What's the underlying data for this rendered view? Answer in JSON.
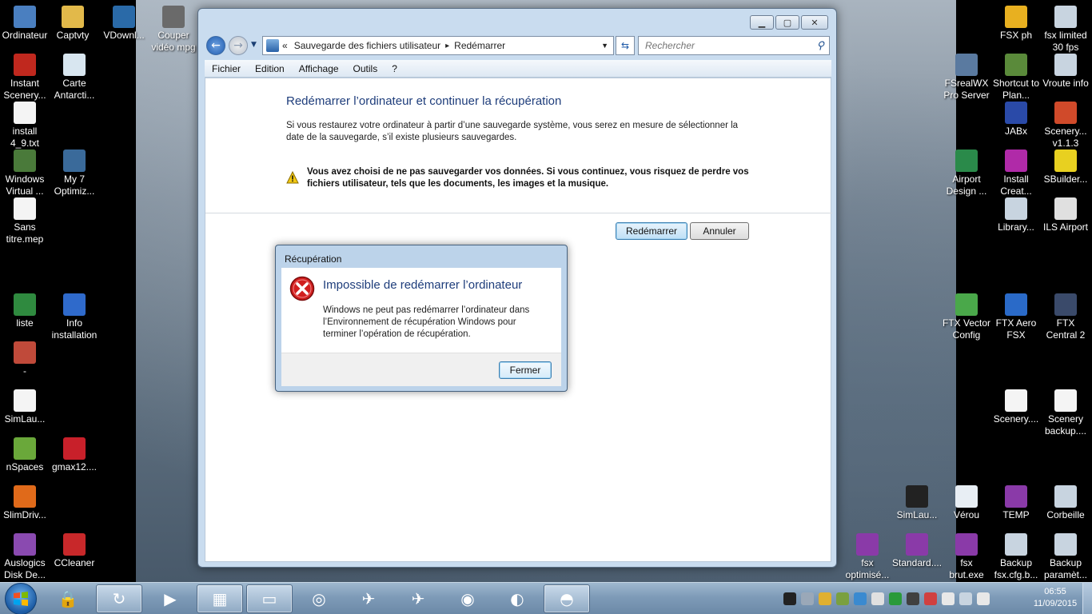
{
  "desktop": {
    "left_icons": [
      {
        "label": "Ordinateur",
        "icon": "computer-icon",
        "color": "#4a7fc0"
      },
      {
        "label": "Captvty",
        "icon": "folder-icon",
        "color": "#e2b94a"
      },
      {
        "label": "VDownl...",
        "icon": "vdownloader-icon",
        "color": "#2a6aa8"
      },
      {
        "label": "Couper vidéo mpg",
        "icon": "video-editor-icon",
        "color": "#6a6a6a"
      },
      {
        "label": "Instant Scenery...",
        "icon": "pdf-icon",
        "color": "#c0281e"
      },
      {
        "label": "Carte Antarcti...",
        "icon": "map-icon",
        "color": "#d8e6f0"
      },
      {
        "label": "install 4_9.txt",
        "icon": "text-file-icon",
        "color": "#f4f4f4"
      },
      {
        "label": "Windows Virtual ...",
        "icon": "virtual-pc-icon",
        "color": "#4a7a3a"
      },
      {
        "label": "My 7 Optimiz...",
        "icon": "optimizer-icon",
        "color": "#3a6a9a"
      },
      {
        "label": "Sans titre.mep",
        "icon": "document-icon",
        "color": "#f4f4f4"
      },
      {
        "label": "liste",
        "icon": "spreadsheet-icon",
        "color": "#2f8a3f"
      },
      {
        "label": "Info installation",
        "icon": "info-icon",
        "color": "#2f6acb"
      },
      {
        "label": "-",
        "icon": "flag-icon",
        "color": "#c04a3a"
      },
      {
        "label": "SimLau...",
        "icon": "document-icon",
        "color": "#f4f4f4"
      },
      {
        "label": "nSpaces",
        "icon": "nspaces-icon",
        "color": "#6aa83a"
      },
      {
        "label": "gmax12....",
        "icon": "gmax-icon",
        "color": "#c8202a"
      },
      {
        "label": "SlimDriv...",
        "icon": "slimdrivers-icon",
        "color": "#e06a1a"
      },
      {
        "label": "Auslogics Disk De...",
        "icon": "defrag-icon",
        "color": "#8a4ab0"
      },
      {
        "label": "CCleaner",
        "icon": "ccleaner-icon",
        "color": "#c8282a"
      }
    ],
    "right_icons": [
      {
        "label": "FSX ph",
        "icon": "fsx-icon",
        "color": "#e8b020"
      },
      {
        "label": "fsx limited 30 fps",
        "icon": "settings-shortcut-icon",
        "color": "#c8d4e0"
      },
      {
        "label": "FSrealWX Pro Server",
        "icon": "weather-server-icon",
        "color": "#5a7aa0"
      },
      {
        "label": "Shortcut to Plan...",
        "icon": "plane-icon",
        "color": "#5a8a3a"
      },
      {
        "label": "Vroute info",
        "icon": "window-icon",
        "color": "#c8d4e0"
      },
      {
        "label": "JABx",
        "icon": "jabx-icon",
        "color": "#2a4aa8"
      },
      {
        "label": "Scenery... v1.1.3",
        "icon": "scenery-icon",
        "color": "#d04a2a"
      },
      {
        "label": "Airport Design ...",
        "icon": "airport-design-icon",
        "color": "#2a8a4a"
      },
      {
        "label": "Install Creat...",
        "icon": "install-icon",
        "color": "#b02aa8"
      },
      {
        "label": "SBuilder...",
        "icon": "sbuilder-icon",
        "color": "#e8d020"
      },
      {
        "label": "Library...",
        "icon": "library-icon",
        "color": "#c8d4e0"
      },
      {
        "label": "ILS Airport",
        "icon": "airport-icon",
        "color": "#e0e0e0"
      },
      {
        "label": "FTX Vector Config",
        "icon": "ftx-vector-icon",
        "color": "#4aa84a"
      },
      {
        "label": "FTX Aero FSX",
        "icon": "ftx-aero-icon",
        "color": "#2a6ac8"
      },
      {
        "label": "FTX Central 2",
        "icon": "ftx-central-icon",
        "color": "#3a4a6a"
      },
      {
        "label": "Scenery....",
        "icon": "document-icon",
        "color": "#f4f4f4"
      },
      {
        "label": "Scenery backup....",
        "icon": "document-icon",
        "color": "#f4f4f4"
      },
      {
        "label": "SimLau...",
        "icon": "airplane-icon",
        "color": "#222222"
      },
      {
        "label": "Vérou",
        "icon": "document-icon",
        "color": "#e8eef4"
      },
      {
        "label": "TEMP",
        "icon": "winrar-icon",
        "color": "#8a3aa8"
      },
      {
        "label": "Corbeille",
        "icon": "recycle-bin-icon",
        "color": "#c8d4e0"
      },
      {
        "label": "fsx optimisé...",
        "icon": "winrar-icon",
        "color": "#8a3aa8"
      },
      {
        "label": "Standard....",
        "icon": "winrar-icon",
        "color": "#8a3aa8"
      },
      {
        "label": "fsx brut.exe",
        "icon": "winrar-icon",
        "color": "#8a3aa8"
      },
      {
        "label": "Backup fsx.cfg.b...",
        "icon": "backup-icon",
        "color": "#c8d4e0"
      },
      {
        "label": "Backup paramèt...",
        "icon": "backup-icon",
        "color": "#c8d4e0"
      }
    ]
  },
  "window": {
    "address": {
      "prefix": "«",
      "crumb1": "Sauvegarde des fichiers utilisateur",
      "separator": "▸",
      "crumb2": "Redémarrer"
    },
    "search_placeholder": "Rechercher",
    "menu": [
      "Fichier",
      "Edition",
      "Affichage",
      "Outils",
      "?"
    ],
    "content": {
      "title": "Redémarrer l’ordinateur et continuer la récupération",
      "description": "Si vous restaurez votre ordinateur à partir d’une sauvegarde système, vous serez en mesure de sélectionner la date de la sauvegarde, s’il existe plusieurs sauvegardes.",
      "warning": "Vous avez choisi de ne pas sauvegarder vos données. Si vous continuez, vous risquez de perdre vos fichiers utilisateur, tels que les documents, les images et la musique.",
      "restart_label": "Redémarrer",
      "cancel_label": "Annuler"
    }
  },
  "dialog": {
    "title": "Récupération",
    "heading": "Impossible de redémarrer l’ordinateur",
    "message": "Windows ne peut pas redémarrer l’ordinateur dans l’Environnement de récupération Windows pour terminer l’opération de récupération.",
    "close_label": "Fermer"
  },
  "taskbar": {
    "apps": [
      {
        "name": "lock-app",
        "icon": "lock-icon",
        "glyph": "🔒",
        "active": false
      },
      {
        "name": "backup-app",
        "icon": "backup-app-icon",
        "glyph": "↻",
        "active": true
      },
      {
        "name": "media-player",
        "icon": "play-icon",
        "glyph": "▶",
        "active": false
      },
      {
        "name": "control-panel",
        "icon": "control-panel-icon",
        "glyph": "▦",
        "active": true
      },
      {
        "name": "file-explorer",
        "icon": "folder-icon",
        "glyph": "▭",
        "active": true
      },
      {
        "name": "ftx-central",
        "icon": "compass-icon",
        "glyph": "◎",
        "active": false
      },
      {
        "name": "simulator",
        "icon": "airplane-icon",
        "glyph": "✈",
        "active": false
      },
      {
        "name": "flight-app",
        "icon": "flight-icon",
        "glyph": "✈",
        "active": false
      },
      {
        "name": "google-earth",
        "icon": "globe-icon",
        "glyph": "◉",
        "active": false
      },
      {
        "name": "firefox",
        "icon": "firefox-icon",
        "glyph": "◐",
        "active": false
      },
      {
        "name": "other-app",
        "icon": "app-icon",
        "glyph": "◓",
        "active": true
      }
    ],
    "clock_time": "06:55",
    "clock_date": "11/09/2015",
    "tray_colors": [
      "#222222",
      "#9aa8b8",
      "#e0b030",
      "#7aa040",
      "#3a8ad0",
      "#e0e0e0",
      "#2a9a3a",
      "#404040",
      "#d04040",
      "#e8e8e8",
      "#c8d4e0",
      "#e8e8e8"
    ]
  }
}
